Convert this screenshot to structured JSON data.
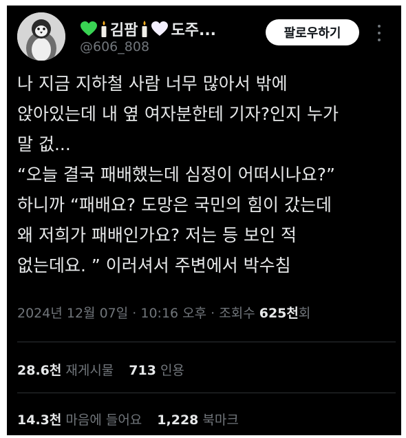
{
  "author": {
    "display_name_text": "김팜",
    "display_name_suffix": "도주...",
    "handle": "@606_808",
    "icons": [
      "green-heart-icon",
      "candle-icon",
      "candle-icon",
      "white-heart-icon"
    ],
    "colors": {
      "green_heart": "#39d353",
      "white_heart": "#f4f0ff",
      "candle": "#f0eee8",
      "flame": "#ffb21f"
    }
  },
  "follow_label": "팔로우하기",
  "tweet": {
    "lines": [
      "나 지금 지하철 사람 너무 많아서 밖에",
      "앉아있는데 내 옆 여자분한테 기자?인지 누가",
      "말 겂...",
      "“오늘 결국 패배했는데 심정이 어떠시나요?”",
      "하니까 “패배요? 도망은 국민의 힘이 갔는데",
      "왜 저희가 패배인가요? 저는 등 보인 적",
      "없는데요. ” 이러셔서 주변에서 박수침"
    ]
  },
  "meta": {
    "date": "2024년 12월 07일",
    "sep1": " · ",
    "time": "10:16 오후",
    "sep2": " · ",
    "views_label": "조회수 ",
    "views_count": "625천",
    "views_suffix": "회"
  },
  "stats": {
    "reposts": {
      "count": "28.6천",
      "label": "재게시물"
    },
    "quotes": {
      "count": "713",
      "label": "인용"
    },
    "likes": {
      "count": "14.3천",
      "label": "마음에 들어요"
    },
    "bookmarks": {
      "count": "1,228",
      "label": "북마크"
    }
  },
  "theme": {
    "background": "#000000",
    "text": "#e7e9ea",
    "muted": "#71767b",
    "divider": "#2f3336"
  }
}
